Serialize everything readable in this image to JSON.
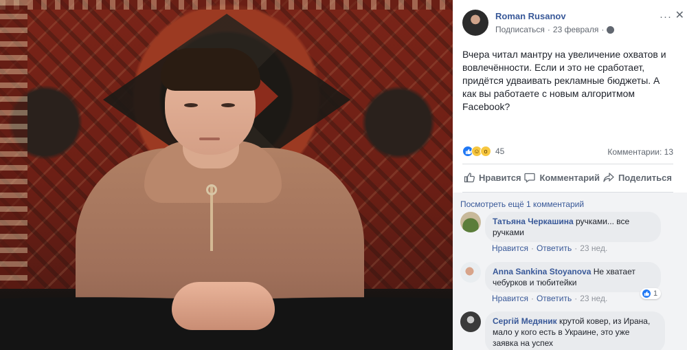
{
  "post": {
    "author": "Roman Rusanov",
    "follow": "Подписаться",
    "separator": "·",
    "date": "23 февраля",
    "more": "···",
    "close": "✕",
    "text": "Вчера читал мантру на увеличение охватов и вовлечённости. Если и это не сработает, придётся удваивать рекламные бюджеты. А как вы работаете с новым алгоритмом Facebook?",
    "reactions_count": "45",
    "reaction_icons": [
      "like-icon",
      "haha-icon",
      "wow-icon"
    ],
    "comments_label": "Комментарии: 13"
  },
  "actions": {
    "like": "Нравится",
    "comment": "Комментарий",
    "share": "Поделиться"
  },
  "comments": {
    "see_more": "Посмотреть ещё 1 комментарий",
    "like_label": "Нравится",
    "reply_label": "Ответить",
    "dot": "·",
    "items": [
      {
        "name": "Татьяна Черкашина",
        "text": "ручками... все ручками",
        "time": "23 нед."
      },
      {
        "name": "Anna Sankina Stoyanova",
        "text": "Не хватает чебурков и тюбитейки",
        "time": "23 нед.",
        "likes": "1"
      },
      {
        "name": "Сергій Медяник",
        "text": "крутой ковер, из Ирана, мало у кого есть в Украине, это уже заявка на успех"
      }
    ]
  },
  "colors": {
    "link": "#385898",
    "secondary": "#606770",
    "bubble": "#e9ebee",
    "like_blue": "#2078f4"
  }
}
